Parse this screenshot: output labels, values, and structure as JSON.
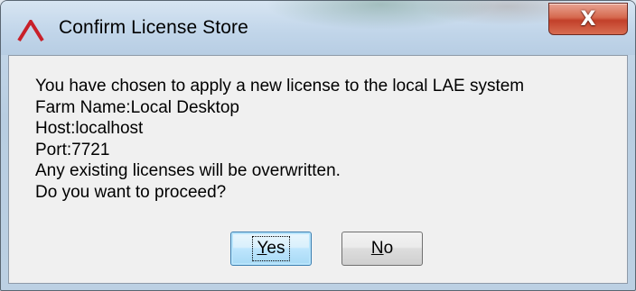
{
  "window": {
    "title": "Confirm License Store",
    "close_glyph": "X",
    "logo_icon": "red-chevron-logo-icon",
    "close_color": "#c94a34"
  },
  "message": {
    "lines": [
      "You have chosen to apply a new license to the local LAE system",
      "Farm Name:Local Desktop",
      "Host:localhost",
      "Port:7721",
      "Any existing licenses will be overwritten.",
      "Do you want to proceed?"
    ]
  },
  "buttons": {
    "yes": {
      "mnemonic": "Y",
      "rest": "es"
    },
    "no": {
      "mnemonic": "N",
      "rest": "o"
    }
  }
}
